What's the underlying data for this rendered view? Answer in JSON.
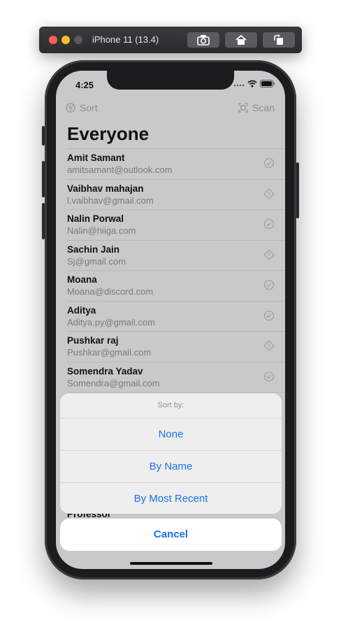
{
  "simulator": {
    "title": "iPhone 11 (13.4)"
  },
  "status_bar": {
    "time": "4:25"
  },
  "nav": {
    "sort_label": "Sort",
    "scan_label": "Scan"
  },
  "page": {
    "title": "Everyone"
  },
  "contacts": [
    {
      "name": "Amit Samant",
      "email": "amitsamant@outlook.com",
      "status_icon": "checkmark-circle-icon"
    },
    {
      "name": "Vaibhav mahajan",
      "email": "l.vaibhav@gmail.com",
      "status_icon": "diamond-question-icon"
    },
    {
      "name": "Nalin Porwal",
      "email": "Nalin@hiiga.com",
      "status_icon": "checkmark-circle-icon"
    },
    {
      "name": "Sachin Jain",
      "email": "Sj@gmail.com",
      "status_icon": "diamond-question-icon"
    },
    {
      "name": "Moana",
      "email": "Moana@discord.com",
      "status_icon": "checkmark-circle-icon"
    },
    {
      "name": "Aditya",
      "email": "Aditya.py@gmail.com",
      "status_icon": "checkmark-circle-icon"
    },
    {
      "name": "Pushkar raj",
      "email": "Pushkar@gmail.com",
      "status_icon": "diamond-question-icon"
    },
    {
      "name": "Somendra Yadav",
      "email": "Somendra@gmail.com",
      "status_icon": "checkmark-circle-icon"
    }
  ],
  "peek_row": {
    "name": "Professor"
  },
  "action_sheet": {
    "title": "Sort by:",
    "options": [
      "None",
      "By Name",
      "By Most Recent"
    ],
    "cancel_label": "Cancel"
  },
  "colors": {
    "accent": "#1a73e8",
    "dim_background": "#c9c9c9"
  }
}
